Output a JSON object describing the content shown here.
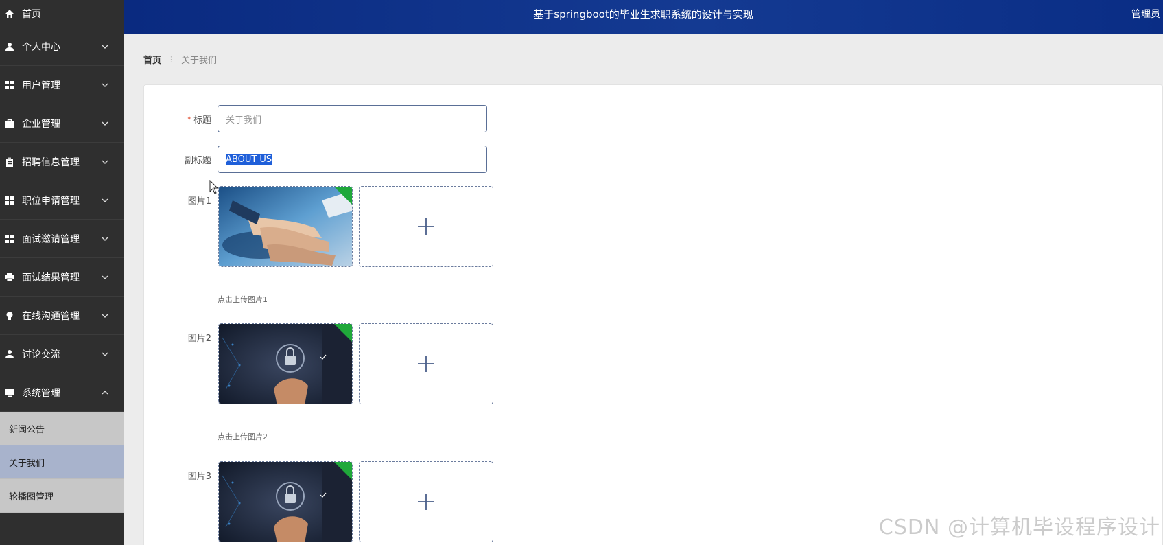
{
  "header": {
    "title": "基于springboot的毕业生求职系统的设计与实现",
    "user": "管理员"
  },
  "sidebar": {
    "home": "首页",
    "items": [
      {
        "label": "个人中心",
        "icon": "user-icon"
      },
      {
        "label": "用户管理",
        "icon": "grid-icon"
      },
      {
        "label": "企业管理",
        "icon": "briefcase-icon"
      },
      {
        "label": "招聘信息管理",
        "icon": "clipboard-icon"
      },
      {
        "label": "职位申请管理",
        "icon": "grid-icon"
      },
      {
        "label": "面试邀请管理",
        "icon": "grid-icon"
      },
      {
        "label": "面试结果管理",
        "icon": "printer-icon"
      },
      {
        "label": "在线沟通管理",
        "icon": "bulb-icon"
      },
      {
        "label": "讨论交流",
        "icon": "user-icon"
      },
      {
        "label": "系统管理",
        "icon": "monitor-icon"
      }
    ],
    "submenu": [
      "新闻公告",
      "关于我们",
      "轮播图管理"
    ]
  },
  "breadcrumb": {
    "home": "首页",
    "current": "关于我们"
  },
  "form": {
    "title_label": "标题",
    "title_placeholder": "关于我们",
    "subtitle_label": "副标题",
    "subtitle_value": "ABOUT US",
    "images": [
      {
        "label": "图片1",
        "hint": "点击上传图片1"
      },
      {
        "label": "图片2",
        "hint": "点击上传图片2"
      },
      {
        "label": "图片3",
        "hint": ""
      }
    ]
  },
  "watermark": "CSDN @计算机毕设程序设计",
  "colors": {
    "header": "#0a2a80",
    "sidebar": "#2f2f2f",
    "submenu_active": "#a8b3cc",
    "selection": "#1f5fd9"
  }
}
